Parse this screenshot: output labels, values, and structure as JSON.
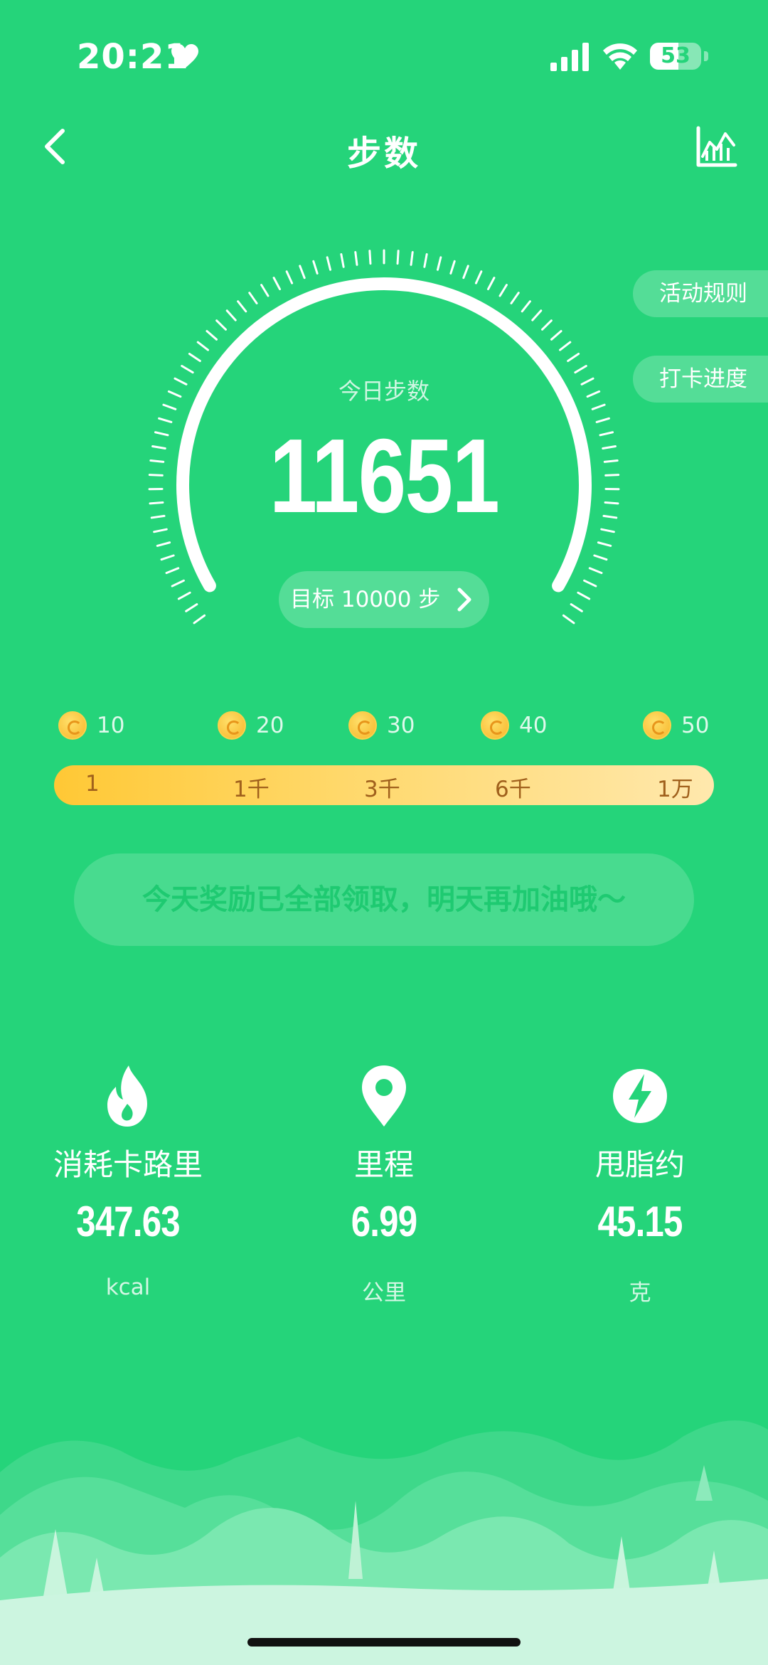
{
  "status_bar": {
    "time": "20:21",
    "battery": "53"
  },
  "nav": {
    "title": "步数"
  },
  "side_buttons": {
    "rules": "活动规则",
    "progress": "打卡进度"
  },
  "gauge": {
    "label": "今日步数",
    "steps": "11651",
    "goal_text": "目标 10000 步",
    "progress_fraction": 1.0
  },
  "rewards": {
    "coins": [
      "10",
      "20",
      "30",
      "40",
      "50"
    ],
    "milestones": [
      "1",
      "1千",
      "3千",
      "6千",
      "1万"
    ],
    "banner": "今天奖励已全部领取，明天再加油哦～"
  },
  "stats": [
    {
      "icon": "flame-icon",
      "label": "消耗卡路里",
      "value": "347.63",
      "unit": "kcal"
    },
    {
      "icon": "location-pin-icon",
      "label": "里程",
      "value": "6.99",
      "unit": "公里"
    },
    {
      "icon": "lightning-icon",
      "label": "甩脂约",
      "value": "45.15",
      "unit": "克"
    }
  ],
  "colors": {
    "background": "#25d47a",
    "track_start": "#ffc835",
    "track_end": "#ffe8ad",
    "banner_text": "#19c86e"
  }
}
